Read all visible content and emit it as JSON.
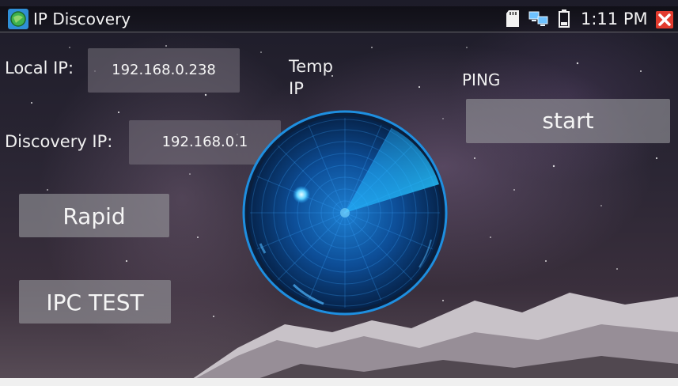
{
  "statusbar": {
    "app_title": "IP Discovery",
    "time": "1:11 PM",
    "icons": [
      "app-logo-icon",
      "sd-card-icon",
      "network-icon",
      "battery-icon",
      "close-icon"
    ],
    "colors": {
      "close": "#e23b2e"
    }
  },
  "form": {
    "local_ip_label": "Local IP:",
    "local_ip_value": "192.168.0.238",
    "discovery_ip_label": "Discovery IP:",
    "discovery_ip_value": "192.168.0.1",
    "temp_ip_label_line1": "Temp",
    "temp_ip_label_line2": "IP"
  },
  "ping": {
    "label": "PING",
    "start_label": "start"
  },
  "buttons": {
    "rapid_label": "Rapid",
    "ipc_test_label": "IPC TEST"
  },
  "radar": {
    "accent": "#1fa9ff"
  }
}
